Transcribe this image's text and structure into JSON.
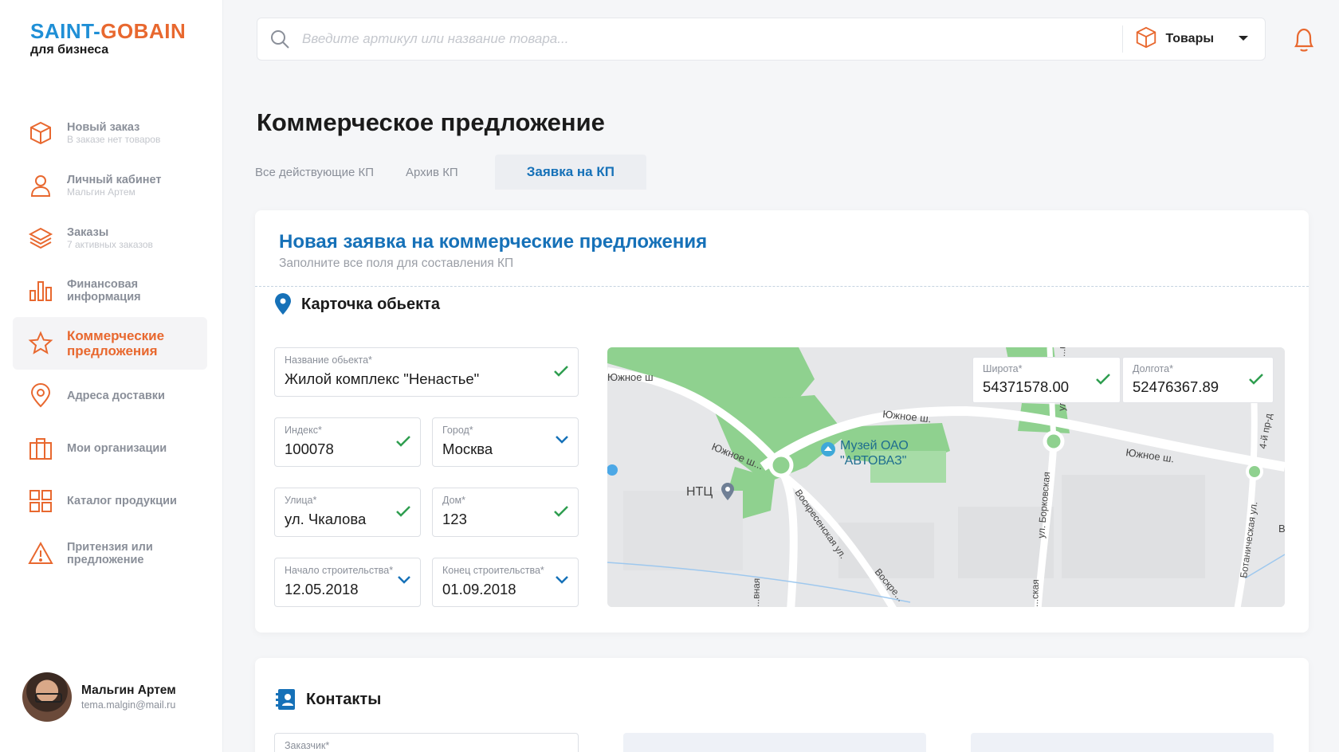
{
  "brand": {
    "name_part1": "SAINT-",
    "name_part2": "GOBAIN",
    "subtitle": "для бизнеса"
  },
  "sidebar": {
    "items": [
      {
        "label": "Новый заказ",
        "sub": "В заказе нет товаров",
        "icon": "cube-icon"
      },
      {
        "label": "Личный кабинет",
        "sub": "Мальгин Артем",
        "icon": "user-icon"
      },
      {
        "label": "Заказы",
        "sub": "7 активных заказов",
        "icon": "layers-icon"
      },
      {
        "label": "Финансовая информация",
        "sub": "",
        "icon": "bar-chart-icon"
      },
      {
        "label": "Коммерческие предложения",
        "sub": "",
        "icon": "star-icon",
        "active": true
      },
      {
        "label": "Адреса доставки",
        "sub": "",
        "icon": "map-pin-icon"
      },
      {
        "label": "Мои организации",
        "sub": "",
        "icon": "briefcase-icon"
      },
      {
        "label": "Каталог продукции",
        "sub": "",
        "icon": "grid-icon"
      },
      {
        "label": "Притензия или предложение",
        "sub": "",
        "icon": "warning-icon"
      }
    ]
  },
  "user": {
    "name": "Мальгин Артем",
    "email": "tema.malgin@mail.ru"
  },
  "search": {
    "placeholder": "Введите артикул или название товара...",
    "value": "",
    "category": "Товары"
  },
  "page": {
    "title": "Коммерческое предложение"
  },
  "tabs": [
    {
      "label": "Все действующие КП",
      "active": false
    },
    {
      "label": "Архив КП",
      "active": false
    },
    {
      "label": "Заявка на КП",
      "active": true
    }
  ],
  "form": {
    "title": "Новая заявка на коммерческие предложения",
    "subtitle": "Заполните все поля для составления КП",
    "object_section": "Карточка обьекта",
    "fields": {
      "object_name": {
        "label": "Название обьекта*",
        "value": "Жилой комплекс \"Ненастье\""
      },
      "index": {
        "label": "Индекс*",
        "value": "100078"
      },
      "city": {
        "label": "Город*",
        "value": "Москва"
      },
      "street": {
        "label": "Улица*",
        "value": "ул. Чкалова"
      },
      "house": {
        "label": "Дом*",
        "value": "123"
      },
      "start": {
        "label": "Начало строительства*",
        "value": "12.05.2018"
      },
      "end": {
        "label": "Конец строительства*",
        "value": "01.09.2018"
      },
      "lat": {
        "label": "Широта*",
        "value": "54371578.00"
      },
      "lon": {
        "label": "Долгота*",
        "value": "52476367.89"
      }
    },
    "map": {
      "labels": {
        "road1": "Южное ш",
        "road2": "Южное ш.",
        "road3": "Южное ш.",
        "road4": "Южное ш...",
        "museum_line1": "Музей ОАО",
        "museum_line2": "\"АВТОВАЗ\"",
        "ntc": "НТЦ",
        "st1": "Воскресенская ул.",
        "st2": "ул. Борковская",
        "st3": "Ботаническая ул.",
        "st4": "4-й пр-д",
        "st5": "Воскре...",
        "st6": "...вная",
        "st7": "...ская",
        "st8": "ул",
        "st9": "...ка",
        "st10": "В"
      }
    },
    "contacts_section": "Контакты",
    "customer": {
      "label": "Заказчик*"
    }
  },
  "colors": {
    "accent_blue": "#1671b8",
    "accent_orange": "#e8682f",
    "check_green": "#2e9e4f"
  }
}
